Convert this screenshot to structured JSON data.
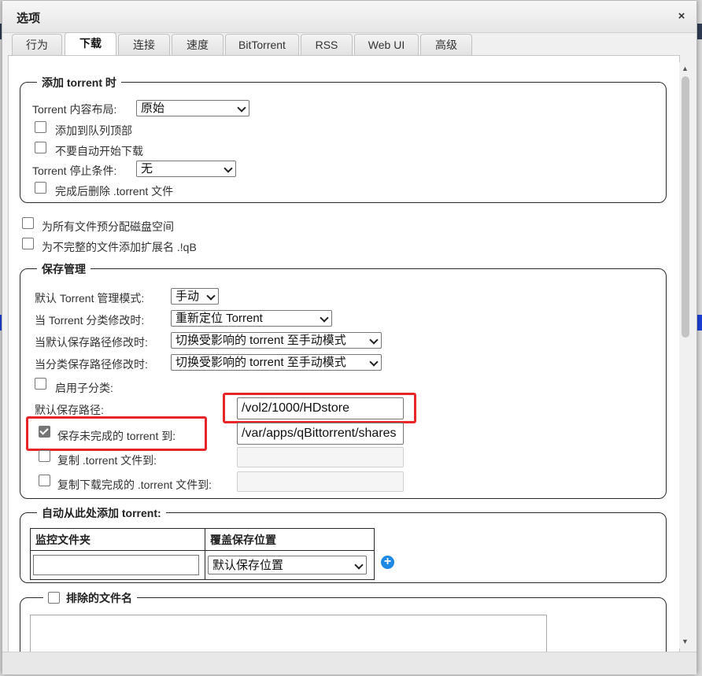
{
  "dialog": {
    "title": "选项",
    "close_glyph": "×"
  },
  "tabs": [
    "行为",
    "下载",
    "连接",
    "速度",
    "BitTorrent",
    "RSS",
    "Web UI",
    "高级"
  ],
  "active_tab": "下载",
  "add_torrent": {
    "legend": "添加 torrent 时",
    "layout_label": "Torrent 内容布局:",
    "layout_value": "原始",
    "top_queue_label": "添加到队列顶部",
    "no_autostart_label": "不要自动开始下载",
    "stop_cond_label": "Torrent 停止条件:",
    "stop_cond_value": "无",
    "delete_after_label": "完成后删除 .torrent 文件"
  },
  "prealloc_label": "为所有文件预分配磁盘空间",
  "append_ext_label": "为不完整的文件添加扩展名 .!qB",
  "save_mgmt": {
    "legend": "保存管理",
    "mode_label": "默认 Torrent 管理模式:",
    "mode_value": "手动",
    "cat_change_label": "当 Torrent 分类修改时:",
    "cat_change_value": "重新定位 Torrent",
    "default_path_change_label": "当默认保存路径修改时:",
    "default_path_change_value": "切换受影响的 torrent 至手动模式",
    "cat_path_change_label": "当分类保存路径修改时:",
    "cat_path_change_value": "切换受影响的 torrent 至手动模式",
    "subcat_label": "启用子分类:",
    "default_save_path_label": "默认保存路径:",
    "default_save_path_value": "/vol2/1000/HDstore",
    "incomplete_label": "保存未完成的 torrent 到:",
    "incomplete_value": "/var/apps/qBittorrent/shares",
    "copy_torrent_label": "复制 .torrent 文件到:",
    "copy_finished_label": "复制下载完成的 .torrent 文件到:"
  },
  "auto_add": {
    "legend": "自动从此处添加 torrent:",
    "col_watch": "监控文件夹",
    "col_override": "覆盖保存位置",
    "override_value": "默认保存位置",
    "add_glyph": "+"
  },
  "exclude": {
    "legend": "排除的文件名"
  },
  "colors": {
    "highlight": "#e8262a",
    "add_icon": "#1e88e5"
  }
}
